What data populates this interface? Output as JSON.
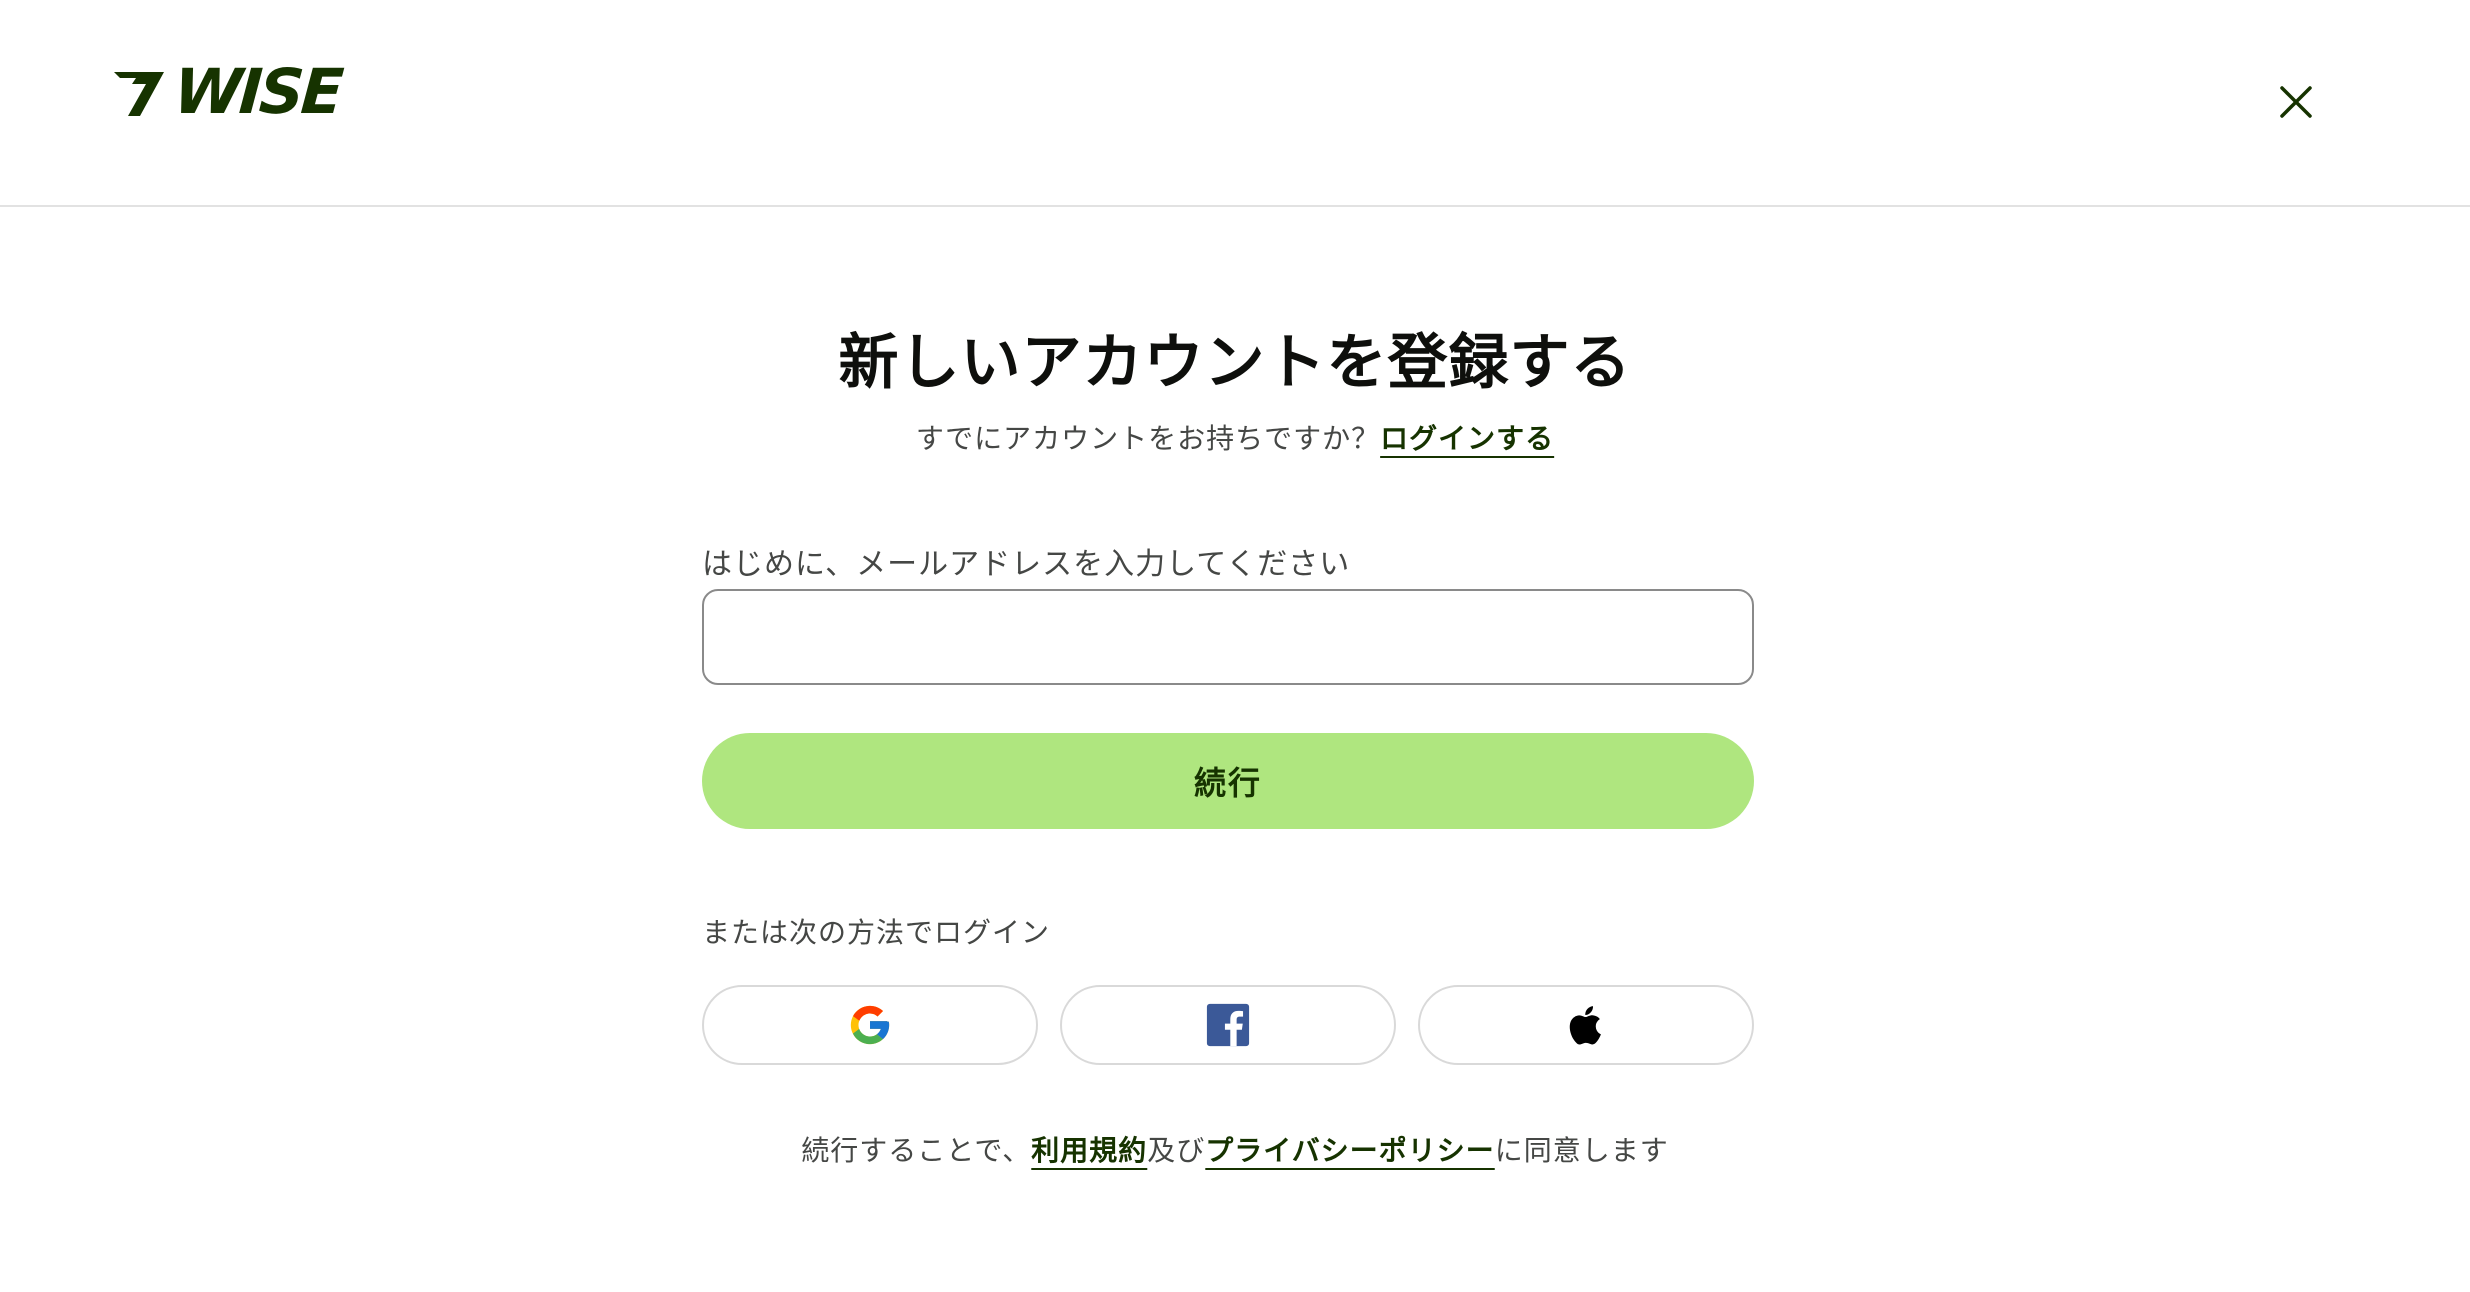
{
  "brand": {
    "name": "WISE",
    "accent_color": "#163300",
    "button_color": "#afe67f"
  },
  "header": {
    "close_icon": "close-icon"
  },
  "signup": {
    "title": "新しいアカウントを登録する",
    "existing_account_text": "すでにアカウントをお持ちですか？",
    "login_link": "ログインする",
    "email_label": "はじめに、メールアドレスを入力してください",
    "email_value": "",
    "email_placeholder": "",
    "continue_label": "続行",
    "or_label": "または次の方法でログイン",
    "social": [
      {
        "provider": "google",
        "icon": "google-icon"
      },
      {
        "provider": "facebook",
        "icon": "facebook-icon"
      },
      {
        "provider": "apple",
        "icon": "apple-icon"
      }
    ],
    "terms_prefix": "続行することで、",
    "terms_link": "利用規約",
    "terms_and": "及び",
    "privacy_link": "プライバシーポリシー",
    "terms_suffix": "に同意します"
  }
}
